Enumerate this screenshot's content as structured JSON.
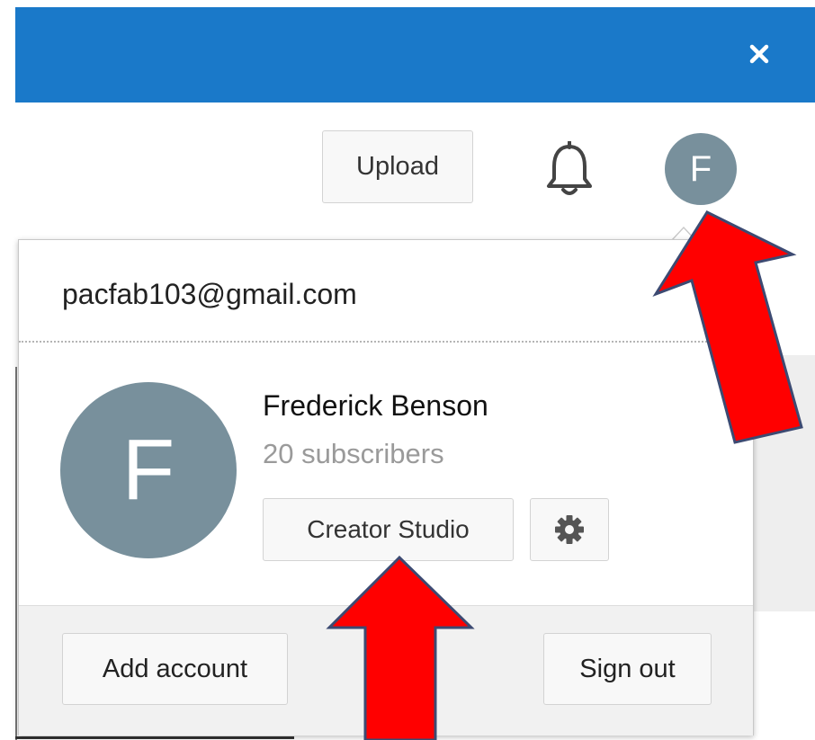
{
  "header": {
    "close_icon": "close-icon",
    "bar_color": "#1a79c9"
  },
  "toolbar": {
    "upload_label": "Upload",
    "notification_icon": "bell-icon",
    "avatar_initial": "F"
  },
  "account_menu": {
    "email": "pacfab103@gmail.com",
    "avatar_initial": "F",
    "name": "Frederick Benson",
    "subscribers": "20 subscribers",
    "creator_studio_label": "Creator Studio",
    "settings_icon": "gear-icon",
    "add_account_label": "Add account",
    "sign_out_label": "Sign out"
  },
  "annotations": {
    "arrow_color": "#ff0000"
  }
}
